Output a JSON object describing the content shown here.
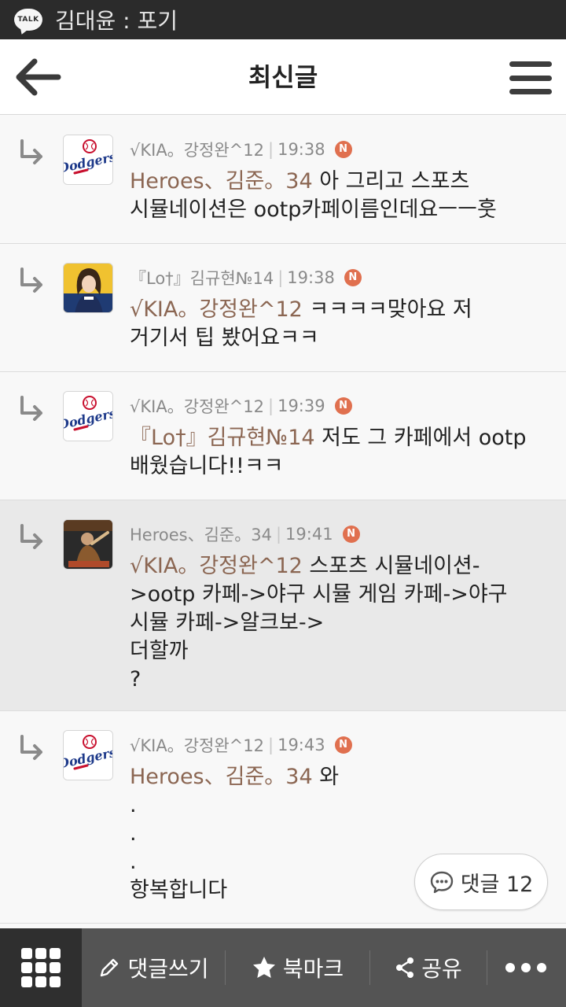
{
  "status_bar": {
    "app_icon_text": "TALK",
    "text": "김대윤 : 포기"
  },
  "header": {
    "title": "최신글"
  },
  "comments": [
    {
      "author": "√KIA。강정완^12",
      "time": "19:38",
      "badge": "N",
      "mention": "Heroes、김준。34",
      "text": " 아 그리고 스포츠\n시뮬네이션은 ootp카페이름인데요ㅡㅡ훗",
      "avatar": "dodgers"
    },
    {
      "author": "『Lo†』김규현№14",
      "time": "19:38",
      "badge": "N",
      "mention": "√KIA。강정완^12",
      "text": " ㅋㅋㅋㅋ맞아요 저\n거기서 팁 봤어요ㅋㅋ",
      "avatar": "girl"
    },
    {
      "author": "√KIA。강정완^12",
      "time": "19:39",
      "badge": "N",
      "mention": "『Lo†』김규현№14",
      "text": " 저도 그 카페에서 ootp\n배웠습니다!!ㅋㅋ",
      "avatar": "dodgers"
    },
    {
      "author": "Heroes、김준。34",
      "time": "19:41",
      "badge": "N",
      "mention": "√KIA。강정완^12",
      "text": " 스포츠 시뮬네이션-\n>ootp 카페->야구 시뮬 게임 카페->야구\n시뮬 카페->알크보->\n더할까\n?",
      "avatar": "player"
    },
    {
      "author": "√KIA。강정완^12",
      "time": "19:43",
      "badge": "N",
      "mention": "Heroes、김준。34",
      "text": " 와\n.\n.\n.\n항복합니다",
      "avatar": "dodgers"
    }
  ],
  "reply_button": {
    "label": "댓글 12"
  },
  "bottom_bar": {
    "write_label": "댓글쓰기",
    "bookmark_label": "북마크",
    "share_label": "공유"
  },
  "icons": [
    "talk-icon",
    "back-arrow-icon",
    "hamburger-menu-icon",
    "reply-arrow-icon",
    "new-badge-icon",
    "speech-bubble-icon",
    "grid-icon",
    "pencil-icon",
    "star-icon",
    "share-icon",
    "more-icon"
  ],
  "colors": {
    "mention": "#8b6652",
    "badge": "#e0704f",
    "bottom_bar": "#545454",
    "status_bar": "#2b2b2b"
  }
}
